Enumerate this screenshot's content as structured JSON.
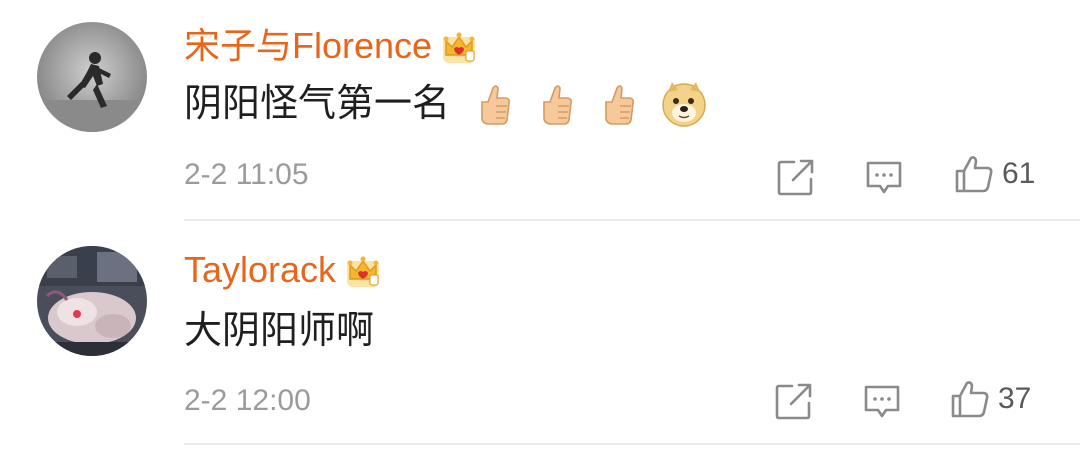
{
  "comments": [
    {
      "username": "宋子与Florence",
      "text": "阴阳怪气第一名",
      "emojis": [
        "thumbs-up",
        "thumbs-up",
        "thumbs-up",
        "doge"
      ],
      "time": "2-2 11:05",
      "likes": "61"
    },
    {
      "username": "Taylorack",
      "text": "大阴阳师啊",
      "emojis": [],
      "time": "2-2 12:00",
      "likes": "37"
    }
  ],
  "colors": {
    "username": "#e8661c",
    "text": "#1f1f1f",
    "meta": "#9b9b9b",
    "crown": "#f2b632",
    "divider": "#ececec"
  },
  "icons": [
    "crown-vip-icon",
    "repost-icon",
    "comment-icon",
    "like-icon",
    "thumbs-up-emoji",
    "doge-emoji"
  ]
}
